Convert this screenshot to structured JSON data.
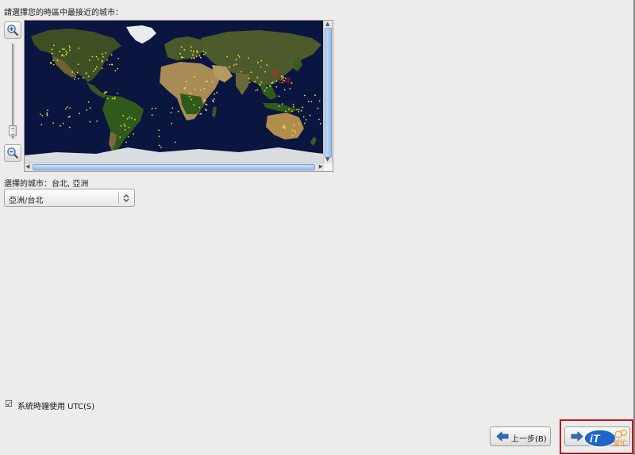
{
  "instruction": "請選擇您的時區中最接近的城市：",
  "map": {
    "selected_city_label": "台北",
    "marker_color": "#e31e24",
    "city_dot_color": "#f0e832",
    "ocean_color": "#0a1540"
  },
  "city_selection": {
    "label": "選擇的城市：台北, 亞洲",
    "value": "亞洲/台北"
  },
  "utc": {
    "checked": true,
    "label": "系統時鐘使用 UTC(S)"
  },
  "buttons": {
    "back": "上一步(B)"
  },
  "watermark": {
    "main": "iT",
    "sub": "幫忙"
  },
  "colors": {
    "background": "#edeceb",
    "highlight_border": "#c0191d",
    "scrollbar_thumb": "#98bde9"
  },
  "icons": {
    "zoom_in": "zoom-in-icon",
    "zoom_out": "zoom-out-icon",
    "back": "left-arrow-icon",
    "next": "right-arrow-icon",
    "dropdown": "updown-chevron-icon"
  }
}
